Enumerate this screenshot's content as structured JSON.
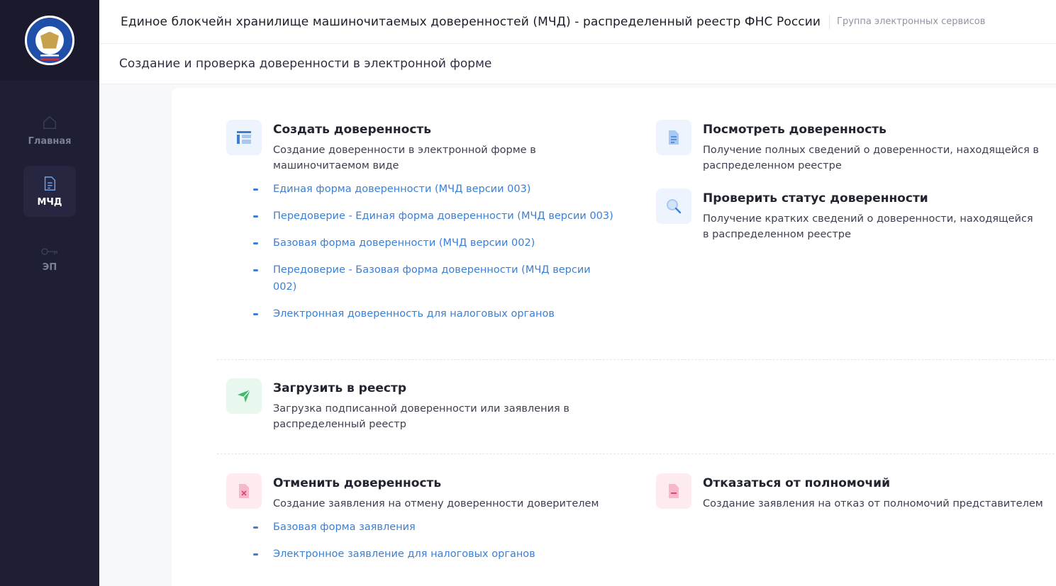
{
  "header": {
    "title": "Единое блокчейн хранилище машиночитаемых доверенностей (МЧД) - распределенный реестр ФНС России",
    "group": "Группа электронных сервисов"
  },
  "subheader": {
    "title": "Создание и проверка доверенности в электронной форме"
  },
  "sidebar": {
    "items": [
      {
        "label": "Главная",
        "icon": "home-icon"
      },
      {
        "label": "МЧД",
        "icon": "document-icon"
      },
      {
        "label": "ЭП",
        "icon": "key-icon"
      }
    ]
  },
  "sections": {
    "create": {
      "title": "Создать доверенность",
      "desc": "Создание доверенности в электронной форме в машиночитаемом виде",
      "links": [
        "Единая форма доверенности (МЧД версии 003)",
        "Передоверие - Единая форма доверенности (МЧД версии 003)",
        "Базовая форма доверенности (МЧД версии 002)",
        "Передоверие - Базовая форма доверенности (МЧД версии 002)",
        "Электронная доверенность для налоговых органов"
      ]
    },
    "view": {
      "title": "Посмотреть доверенность",
      "desc": "Получение полных сведений о доверенности, находящейся в распределенном реестре"
    },
    "check": {
      "title": "Проверить статус доверенности",
      "desc": "Получение кратких сведений о доверенности, находящейся в распределенном реестре"
    },
    "upload": {
      "title": "Загрузить в реестр",
      "desc": "Загрузка подписанной доверенности или заявления в распределенный реестр"
    },
    "cancel": {
      "title": "Отменить доверенность",
      "desc": "Создание заявления на отмену доверенности доверителем",
      "links": [
        "Базовая форма заявления",
        "Электронное заявление для налоговых органов"
      ]
    },
    "refuse": {
      "title": "Отказаться от полномочий",
      "desc": "Создание заявления на отказ от полномочий представителем"
    }
  },
  "colors": {
    "sidebar": "#1e1e34",
    "link": "#3b7fd4",
    "accent_green": "#3fb96b",
    "accent_pink": "#e0457a"
  }
}
